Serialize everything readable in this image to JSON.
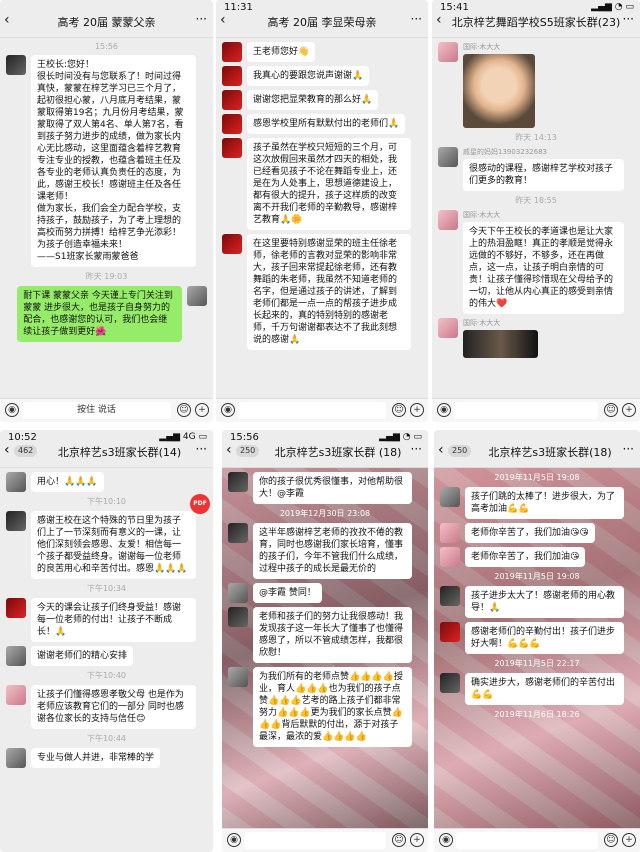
{
  "p1": {
    "title": "高考 20届 蒙蒙父亲",
    "status": "",
    "t1": "15:56",
    "m1": "王校长:您好！\n很长时间没有与您联系了！时间过得真快，蒙蒙在梓艺学习已三个月了，起初很担心蒙，八月底月考结果，蒙蒙取得第19名；九月份月考结果，蒙蒙取得了双人第4名、单人第7名，看到孩子努力进步的成绩，做为家长内心无比感动，这里面蕴含着梓艺教育专注专业的授教，也蕴含着班主任及各专业的老师认真负责任的态度，为此，感谢王校长！感谢班主任及各任课老师！\n做为家长，我们会全力配合学校，支持孩子，鼓励孩子，为了考上理想的高校而努力拼搏！给梓艺争光添彩！为孩子创造幸福未来！\n——S1班家长蒙雨蒙爸爸",
    "t2": "昨天 19:03",
    "m2": "耐下课 蒙蒙父亲 今天谨上专门关注到蒙蒙 进步很大，也是孩子自身努力的配合，也感谢您的认可，我们也会继续让孩子做到更好🌺",
    "input": "按住 说话"
  },
  "p2": {
    "status": "11:31",
    "title": "高考 20届 李显荣母亲",
    "m1": "王老师您好👋",
    "m2": "我真心的要跟您说声谢谢🙏",
    "m3": "谢谢您把显荣教育的那么好🙏",
    "m4": "感恩学校里所有默默付出的老师们🙏",
    "m5": "孩子虽然在学校只短短的三个月，可这次放假回来虽然才四天的相处，我已经看见孩子不论在舞蹈专业上，还是在为人处事上，思想道德建设上，都有很大的提升，孩子这样质的改变离不开我们老师的辛勤教导，感谢梓艺教育🙏🌼",
    "m6": "在这里要特别感谢显荣的班主任徐老师，徐老师的言教对显荣的影响非常大，孩子回来常提起徐老师，还有教舞蹈的朱老师，我虽然不知道老师的名字，但是通过孩子的讲述，了解到老师们都是一点一点的帮孩子进步成长起来的，真的特别特别的感谢老师，千万句谢谢都表达不了我此刻想说的感谢🙏"
  },
  "p3": {
    "status": "15:41",
    "title": "北京梓艺舞蹈学校S5班家长群(23)",
    "n1": "国际·木大大",
    "t1": "昨天 14:13",
    "n2": "戚星的妈妈13903232683",
    "m2": "很感动的课程，感谢梓艺学校对孩子们更多的教育！",
    "t2": "昨天 18:55",
    "n3": "国际·木大大",
    "m3": "今天下午王校长的孝道课也是让大家上的热泪盈眶！真正的孝顺是觉得永远做的不够好，不够多，还在再做点，这一点，让孩子明白亲情的可贵！让孩子懂得珍惜现在父母给予的一切，让他从内心真正的感受到亲情的伟大❤️",
    "n4": "国际·木大大"
  },
  "p4": {
    "status": "10:52",
    "title": "北京梓艺s3班家长群(14)",
    "badge": "462",
    "pdf": "PDF",
    "m0": "用心！🙏🙏🙏",
    "t1": "下午10:10",
    "m1": "感谢王校在这个特殊的节日里为孩子们上了一节深刻而有意义的一课，让他们深刻领会感恩、友爱！相信每一个孩子都受益终身。谢谢每一位老师的良苦用心和辛苦付出。感恩🙏🙏🙏",
    "t2": "下午10:34",
    "m2": "今天的课会让孩子们终身受益！感谢每一位老师的付出！让孩子不断成长！🙏",
    "m3": "谢谢老师们的精心安排",
    "t3": "下午10:40",
    "m4": "让孩子们懂得感恩孝敬父母 也是作为老师应该教育它们的一部分 同时也感谢各位家长的支持与信任😊",
    "t4": "下午10:44",
    "m5": "专业与做人并进，非常棒的学"
  },
  "p5": {
    "status": "15:56",
    "title": "北京梓艺s3班家长群 (18)",
    "badge": "250",
    "m1": "你的孩子很优秀很懂事，对他帮助很大！@李霞",
    "t1": "2019年12月30日 23:08",
    "m2": "这半年感谢梓艺老师的孜孜不倦的教育，同时也感谢我们家长培育，懂事的孩子们，今年不管我们什么成绩，过程中孩子的成长是最无价的",
    "m3": "@李霞 赞同！",
    "m4": "老师和孩子们的努力让我很感动！我发现孩子这一年长大了懂事了也懂得感恩了，所以不管成绩怎样，我都很欣慰！",
    "m5": "为我们所有的老师点赞👍👍👍👍授业，育人👍👍👍也为我们的孩子点赞👍👍👍艺考的路上孩子们都非常努力👍👍👍更为我们的家长点赞👍👍👍背后默默的付出，源于对孩子最深，最浓的爱👍👍👍👍"
  },
  "p6": {
    "title": "北京梓艺s3班家长群(18)",
    "badge": "250",
    "t1": "2019年11月5日 19:08",
    "m1": "孩子们跳的太棒了！进步很大，为了高考加油💪💪",
    "m2": "老师你辛苦了，我们加油😘😘",
    "m3": "老师你辛苦了，我们加油😘",
    "t2": "2019年11月5日 19:08",
    "m4": "孩子进步太大了！感谢老师的用心教导！🙏",
    "m5": "感谢老师们的辛勤付出！孩子们进步好大啊！💪💪💪",
    "t3": "2019年11月5日 22:17",
    "m6": "确实进步大，感谢老师们的辛苦付出💪💪",
    "t4": "2019年11月6日 18:26"
  },
  "icons": {
    "back": "back-chevron-icon",
    "more": "more-dots-icon",
    "voice": "voice-icon",
    "emoji": "emoji-icon",
    "plus": "plus-icon"
  }
}
